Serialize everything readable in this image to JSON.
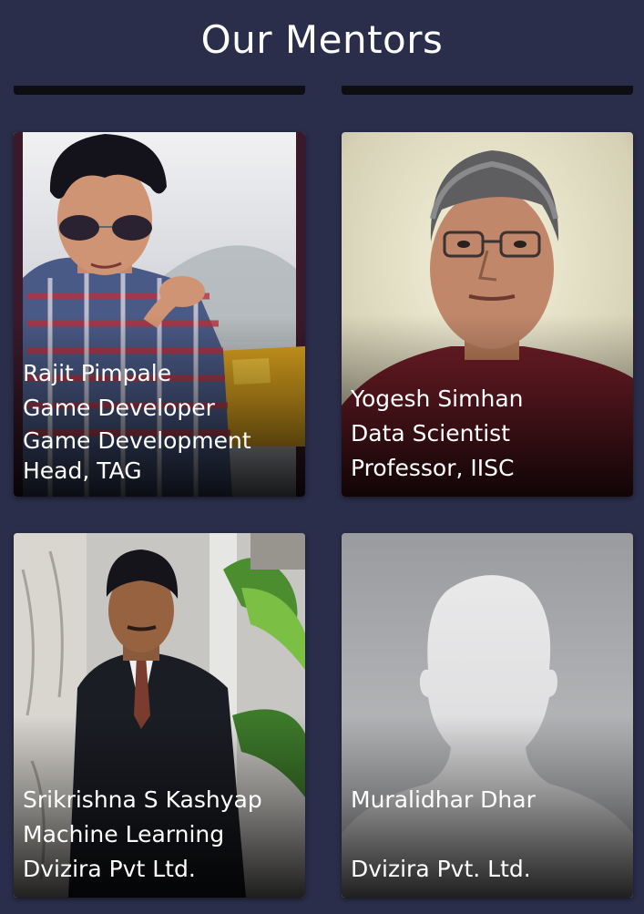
{
  "header": {
    "title": "Our Mentors"
  },
  "mentors": [
    {
      "name": "Rajit Pimpale",
      "role": "Game Developer",
      "affiliation": "Game Development Head, TAG"
    },
    {
      "name": "Yogesh Simhan",
      "role": "Data Scientist",
      "affiliation": "Professor, IISC"
    },
    {
      "name": "Srikrishna S Kashyap",
      "role": "Machine Learning",
      "affiliation": "Dvizira Pvt Ltd."
    },
    {
      "name": "Muralidhar Dhar",
      "role": "",
      "affiliation": "Dvizira Pvt. Ltd."
    }
  ],
  "colors": {
    "background": "#2a2e4a",
    "text": "#ffffff"
  }
}
